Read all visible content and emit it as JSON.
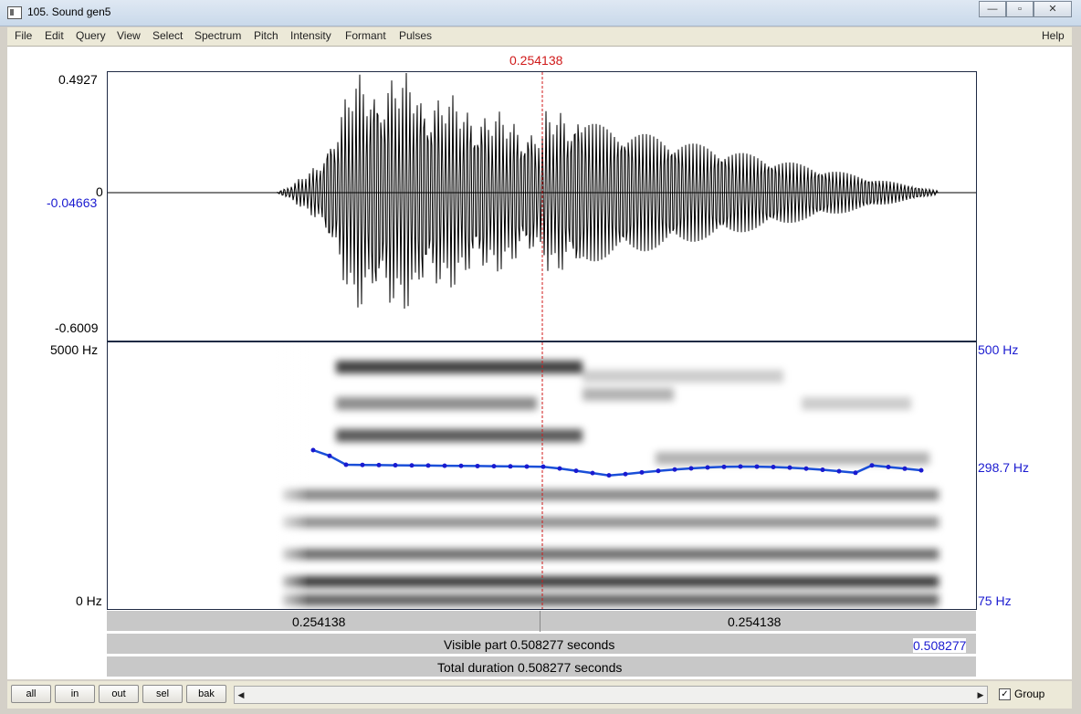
{
  "window": {
    "title": "105. Sound gen5"
  },
  "menu": [
    "File",
    "Edit",
    "Query",
    "View",
    "Select",
    "Spectrum",
    "Pitch",
    "Intensity",
    "Formant",
    "Pulses"
  ],
  "help": "Help",
  "cursor": {
    "time": "0.254138"
  },
  "waveform": {
    "ymax": "0.4927",
    "zero": "0",
    "cursor_value": "-0.04663",
    "ymin": "-0.6009"
  },
  "spectrogram": {
    "fmax": "5000 Hz",
    "fmin": "0 Hz"
  },
  "pitch": {
    "max": "500 Hz",
    "current": "298.7 Hz",
    "min": "75 Hz"
  },
  "bands": {
    "left_time": "0.254138",
    "right_time": "0.254138",
    "visible_start": "0",
    "visible_label": "Visible part 0.508277 seconds",
    "visible_end": "0.508277",
    "total_label": "Total duration 0.508277 seconds"
  },
  "buttons": {
    "all": "all",
    "in": "in",
    "out": "out",
    "sel": "sel",
    "bak": "bak"
  },
  "group": {
    "label": "Group",
    "checked": true
  },
  "colors": {
    "cursor": "#d01a1a",
    "pitch": "#1a4fd8",
    "axis_blue": "#1a1ad0"
  }
}
